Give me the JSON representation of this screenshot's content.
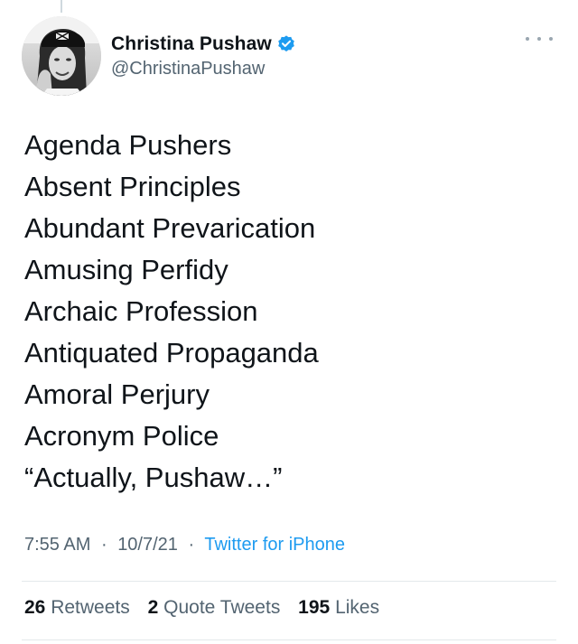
{
  "author": {
    "display_name": "Christina Pushaw",
    "handle": "@ChristinaPushaw",
    "verified": true,
    "avatar": "profile-photo"
  },
  "tweet": {
    "lines": [
      "Agenda Pushers",
      "Absent Principles",
      "Abundant Prevarication",
      "Amusing Perfidy",
      "Archaic Profession",
      "Antiquated Propaganda",
      "Amoral Perjury",
      "Acronym Police",
      "“Actually, Pushaw…”"
    ]
  },
  "meta": {
    "time": "7:55 AM",
    "separator": "·",
    "date": "10/7/21",
    "source": "Twitter for iPhone"
  },
  "stats": {
    "retweets_count": "26",
    "retweets_label": "Retweets",
    "quotes_count": "2",
    "quotes_label": "Quote Tweets",
    "likes_count": "195",
    "likes_label": "Likes"
  },
  "colors": {
    "verified_badge": "#1d9bf0",
    "link": "#1d9bf0",
    "secondary_text": "#536471",
    "primary_text": "#0f1419"
  },
  "icons": {
    "more": "more-options-icon",
    "verified": "verified-badge-icon"
  }
}
